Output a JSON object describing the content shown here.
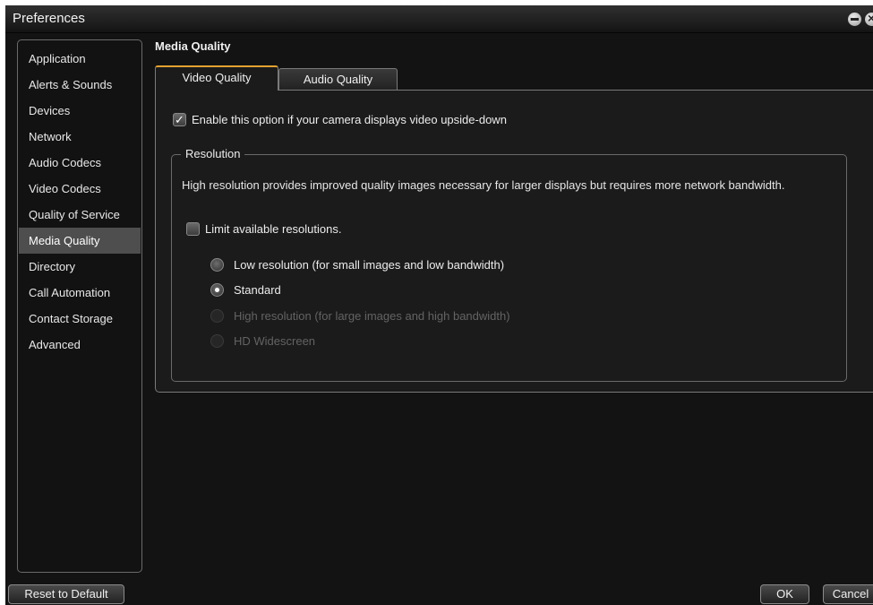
{
  "window": {
    "title": "Preferences"
  },
  "sidebar": {
    "items": [
      {
        "label": "Application"
      },
      {
        "label": "Alerts & Sounds"
      },
      {
        "label": "Devices"
      },
      {
        "label": "Network"
      },
      {
        "label": "Audio Codecs"
      },
      {
        "label": "Video Codecs"
      },
      {
        "label": "Quality of Service"
      },
      {
        "label": "Media Quality",
        "selected": true
      },
      {
        "label": "Directory"
      },
      {
        "label": "Call Automation"
      },
      {
        "label": "Contact Storage"
      },
      {
        "label": "Advanced"
      }
    ]
  },
  "content": {
    "title": "Media Quality",
    "tabs": [
      {
        "label": "Video Quality",
        "active": true
      },
      {
        "label": "Audio Quality",
        "active": false
      }
    ],
    "flip_option": {
      "label": "Enable this option if your camera displays video upside-down",
      "checked": true
    },
    "resolution": {
      "legend": "Resolution",
      "description": "High resolution provides improved quality images necessary for larger displays but requires more network bandwidth.",
      "limit_option": {
        "label": "Limit available resolutions.",
        "checked": false
      },
      "options": [
        {
          "label": "Low resolution (for small images and low bandwidth)",
          "selected": false,
          "enabled": true
        },
        {
          "label": "Standard",
          "selected": true,
          "enabled": true
        },
        {
          "label": "High resolution (for large images and high bandwidth)",
          "selected": false,
          "enabled": false
        },
        {
          "label": "HD Widescreen",
          "selected": false,
          "enabled": false
        }
      ]
    }
  },
  "buttons": {
    "reset": "Reset to Default",
    "ok": "OK",
    "cancel": "Cancel"
  },
  "icons": {
    "minimize": "minimize-icon",
    "close": "close-icon",
    "check": "check-icon"
  },
  "colors": {
    "accent_tab": "#e3a232",
    "background": "#131313",
    "selected_item": "#4e4e4e"
  }
}
